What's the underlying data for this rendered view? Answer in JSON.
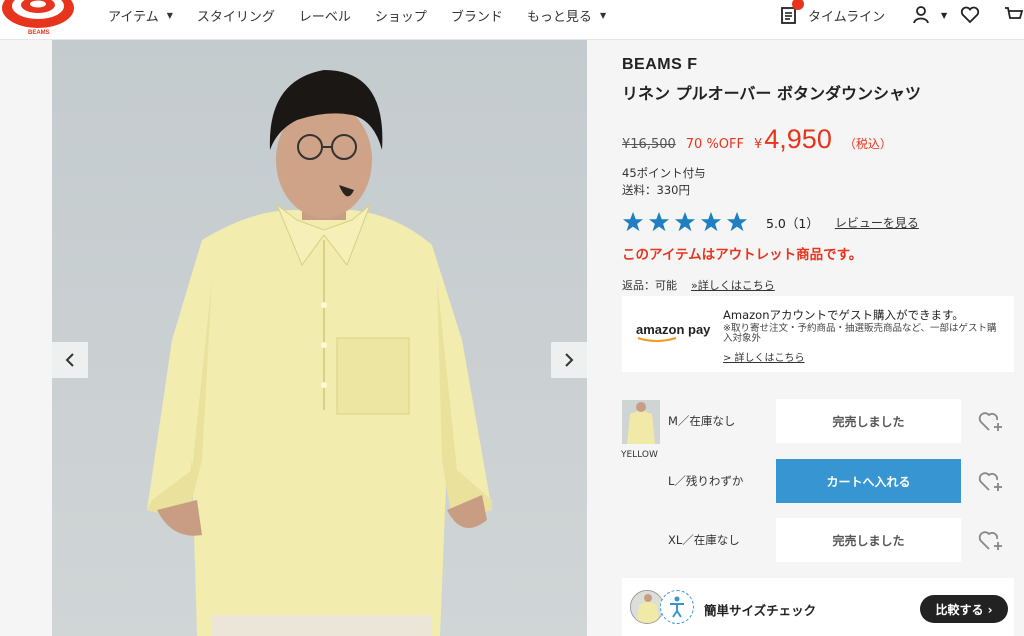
{
  "header": {
    "logo_text": "BEAMS",
    "nav": [
      {
        "label": "アイテム",
        "has_dropdown": true
      },
      {
        "label": "スタイリング",
        "has_dropdown": false
      },
      {
        "label": "レーベル",
        "has_dropdown": false
      },
      {
        "label": "ショップ",
        "has_dropdown": false
      },
      {
        "label": "ブランド",
        "has_dropdown": false
      },
      {
        "label": "もっと見る",
        "has_dropdown": true
      }
    ],
    "timeline_label": "タイムライン",
    "icons": [
      "timeline-icon",
      "user-icon",
      "heart-icon",
      "cart-icon"
    ]
  },
  "product": {
    "brand": "BEAMS F",
    "title": "リネン プルオーバー ボタンダウンシャツ",
    "original_price": "¥16,500",
    "discount": "70 %OFF",
    "currency": "¥",
    "price": "4,950",
    "tax_note": "（税込）",
    "points": "45ポイント付与",
    "shipping": "送料：330円",
    "rating_value": 5,
    "rating_text": "5.0（1）",
    "review_link": "レビューを見る",
    "outlet_notice": "このアイテムはアウトレット商品です。",
    "returns_label": "返品：可能",
    "returns_link": "»詳しくはこちら"
  },
  "amazon_pay": {
    "logo_text": "amazon pay",
    "title": "Amazonアカウントでゲスト購入ができます。",
    "note": "※取り寄せ注文・予約商品・抽選販売商品など、一部はゲスト購入対象外",
    "link": "> 詳しくはこちら"
  },
  "variants": {
    "color_label": "YELLOW",
    "sizes": [
      {
        "label": "M／在庫なし",
        "button": "完売しました",
        "available": false
      },
      {
        "label": "L／残りわずか",
        "button": "カートへ入れる",
        "available": true
      },
      {
        "label": "XL／在庫なし",
        "button": "完売しました",
        "available": false
      }
    ]
  },
  "size_check": {
    "label": "簡単サイズチェック",
    "compare_button": "比較する ›"
  },
  "colors": {
    "accent_red": "#e8341c",
    "cart_blue": "#3796d1",
    "star_blue": "#1f7fc0"
  }
}
